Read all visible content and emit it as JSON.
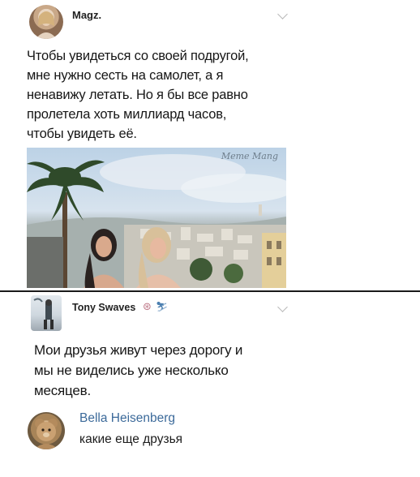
{
  "post1": {
    "author": "Magz.",
    "text": "Чтобы увидеться со своей подругой,\nмне нужно сесть на самолет, а я\nненавижу летать. Но я бы все равно\nпролетела хоть миллиард часов,\nчтобы увидеть её.",
    "image": {
      "watermark": "Meme Mang"
    }
  },
  "post2": {
    "author": "Tony Swaves",
    "text": "Мои друзья живут через дорогу и\nмы не виделись уже несколько\nмесяцев."
  },
  "comment": {
    "author": "Bella Heisenberg",
    "text": "какие еще друзья"
  },
  "colors": {
    "comment_author": "#3c6a9a",
    "divider": "#1a1a1a",
    "chevron": "#b8b8b8"
  }
}
